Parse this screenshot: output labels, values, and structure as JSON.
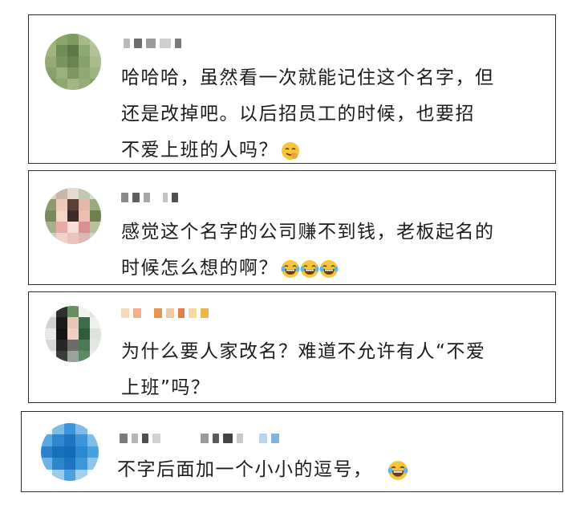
{
  "comments": [
    {
      "lines": [
        "哈哈哈，虽然看一次就能记住这个名字，但",
        "还是改掉吧。以后招员工的时候，也要招",
        "不爱上班的人吗？"
      ],
      "emoji": [
        "yum-face-icon"
      ]
    },
    {
      "lines": [
        "感觉这个名字的公司赚不到钱，老板起名的",
        "时候怎么想的啊？"
      ],
      "emoji": [
        "laughing-tears-icon",
        "laughing-tears-icon",
        "laughing-tears-icon"
      ]
    },
    {
      "lines": [
        "为什么要人家改名？难道不允许有人“不爱",
        "上班”吗？"
      ],
      "emoji": []
    },
    {
      "lines": [
        "不字后面加一个小小的逗号，"
      ],
      "emoji": [
        "laughing-tears-icon"
      ]
    }
  ],
  "colors": {
    "border": "#2b2b2b",
    "text": "#1c1c1c",
    "accent": "#f39c39"
  }
}
